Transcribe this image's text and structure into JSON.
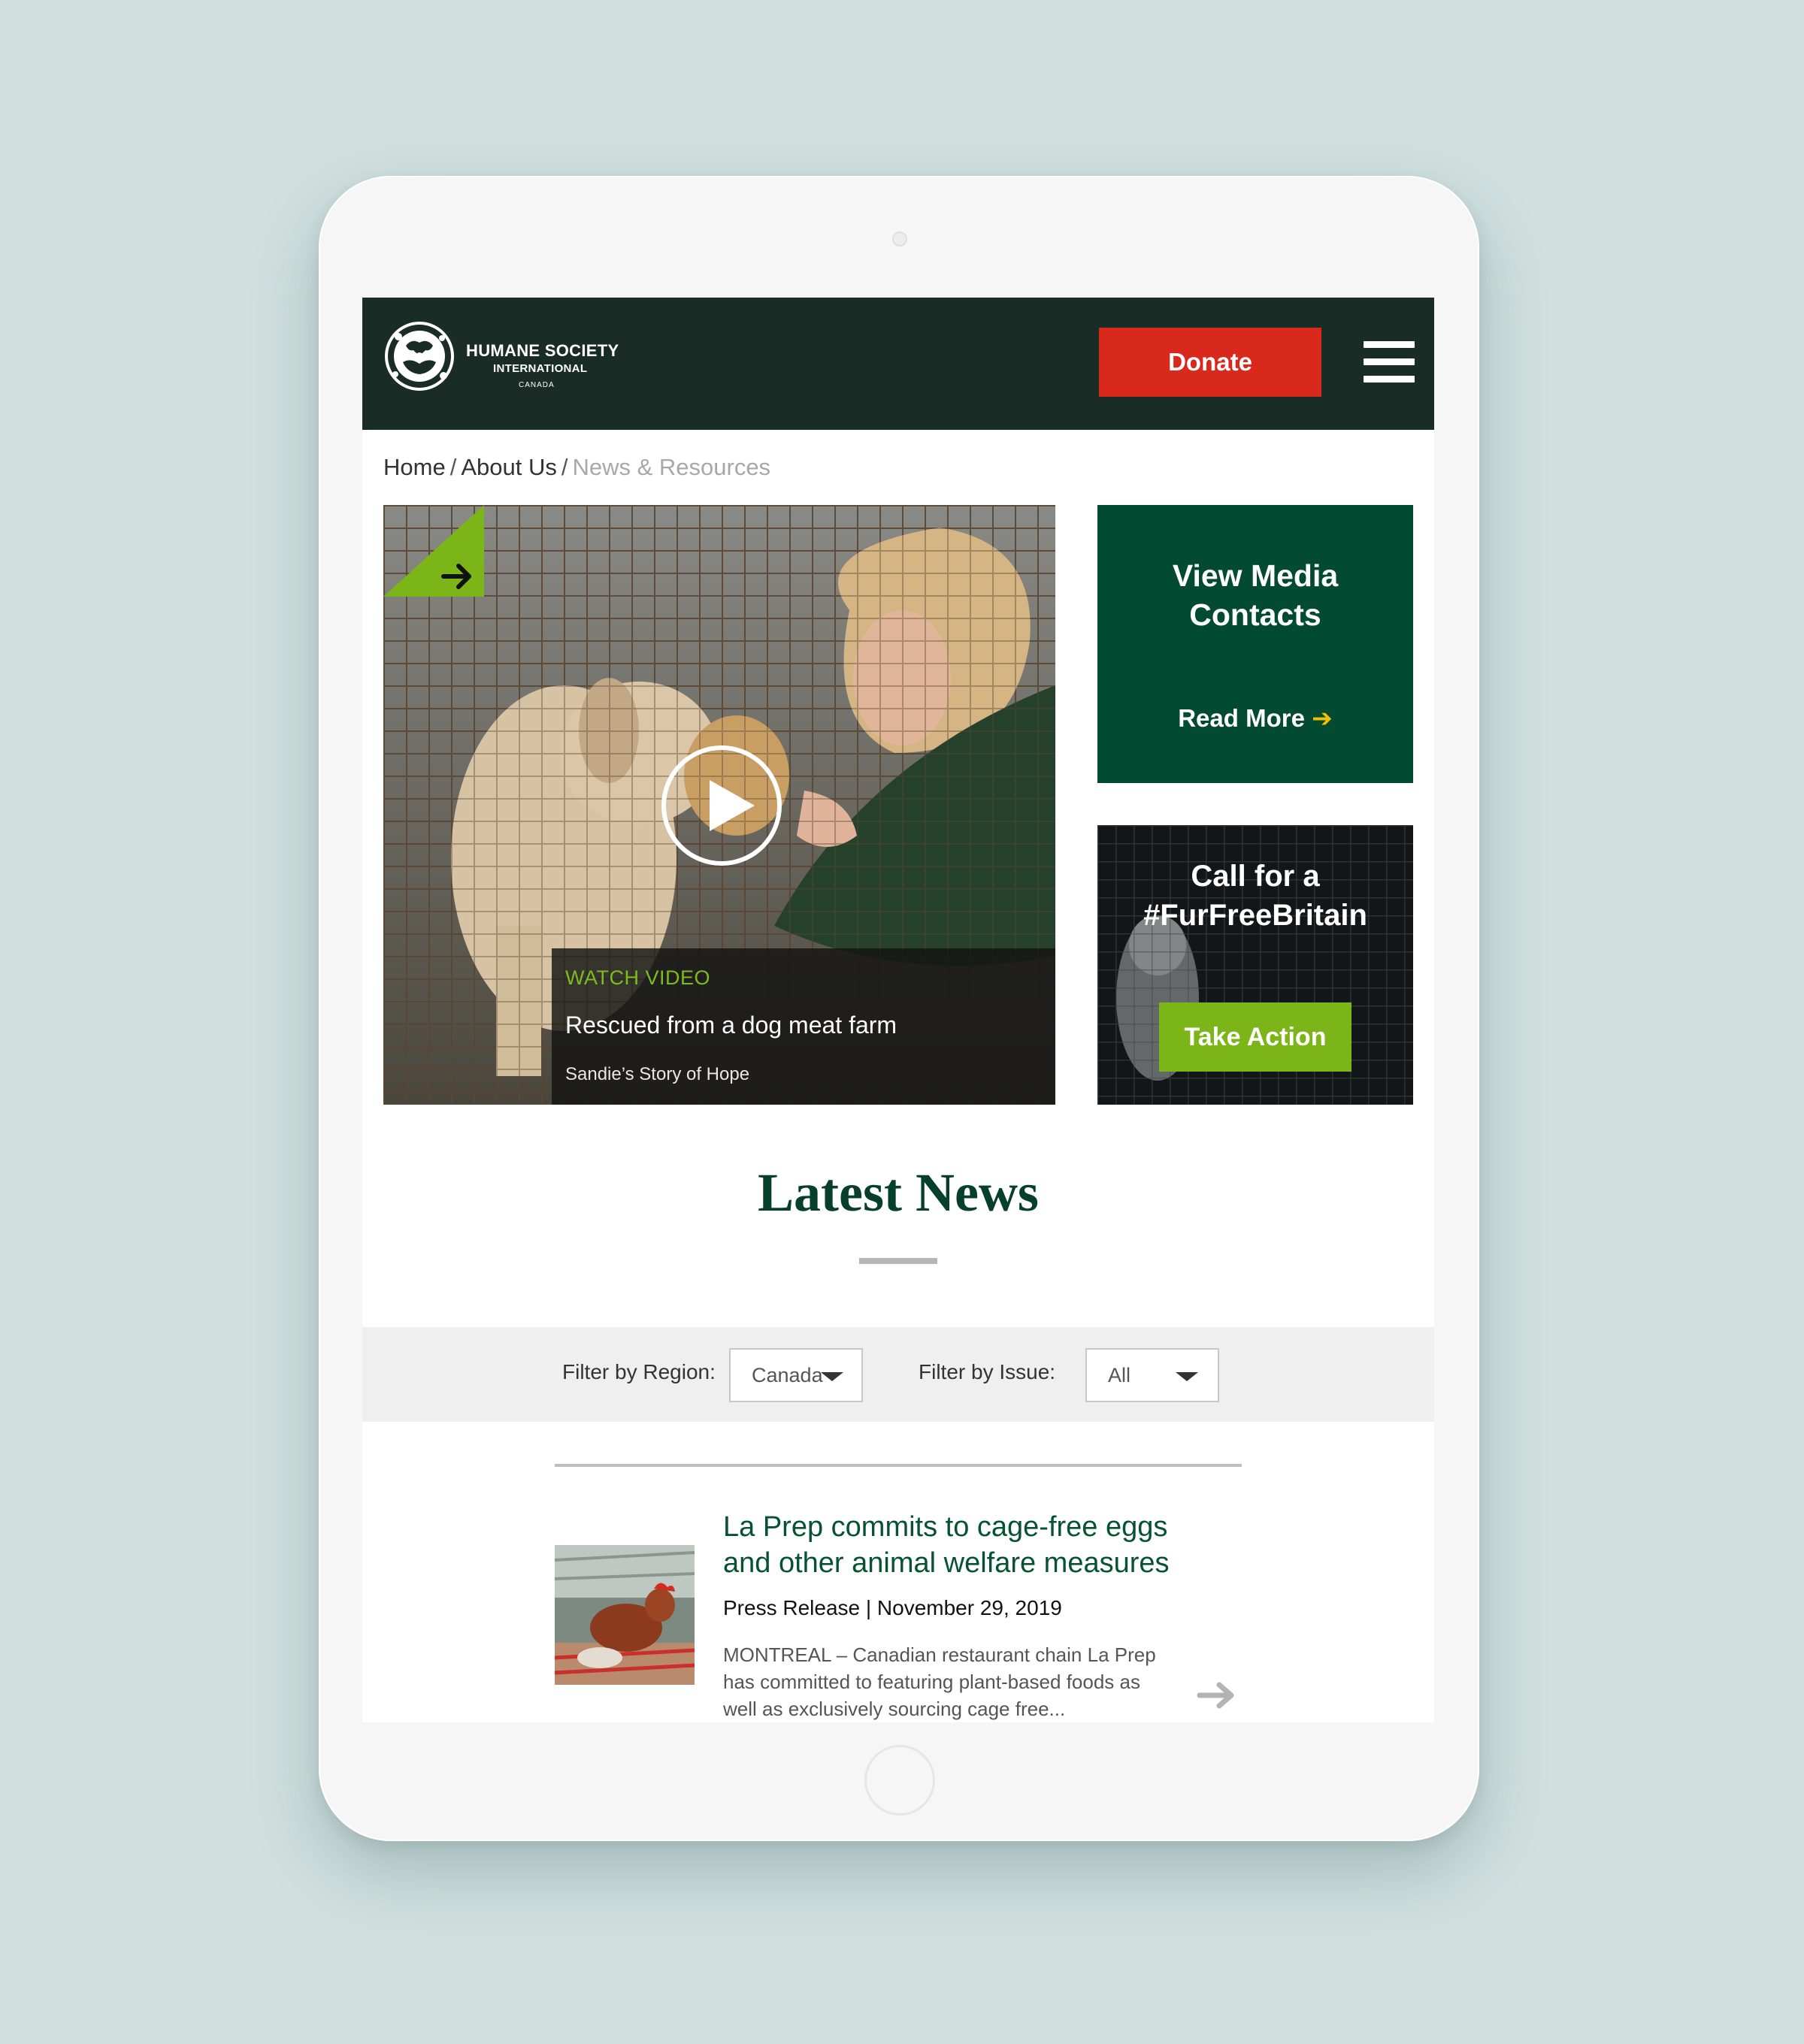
{
  "header": {
    "logo_line1": "HUMANE SOCIETY",
    "logo_line2": "INTERNATIONAL",
    "logo_line3": "CANADA",
    "donate_label": "Donate"
  },
  "breadcrumb": {
    "home": "Home",
    "about": "About Us",
    "current": "News & Resources",
    "separator": "/"
  },
  "hero": {
    "watch_label": "WATCH VIDEO",
    "title": "Rescued from a dog meat farm",
    "subtitle": "Sandie’s Story of Hope"
  },
  "media_card": {
    "title_line1": "View Media",
    "title_line2": "Contacts",
    "read_more": "Read More"
  },
  "fur_card": {
    "title_line1": "Call for a",
    "title_line2": "#FurFreeBritain",
    "button_label": "Take Action"
  },
  "latest_news": {
    "title": "Latest News"
  },
  "filters": {
    "region_label": "Filter by Region:",
    "region_value": "Canada",
    "issue_label": "Filter by Issue:",
    "issue_value": "All"
  },
  "news_items": [
    {
      "title": "La Prep commits to cage-free eggs and other animal welfare measures",
      "meta": "Press Release | November 29, 2019",
      "excerpt": "MONTREAL – Canadian restaurant chain La Prep has committed to featuring plant-based foods as well as exclusively sourcing cage free..."
    }
  ],
  "colors": {
    "header_bg": "#1a2c26",
    "donate": "#d9291c",
    "brand_green": "#034a32",
    "action_green": "#7cb518",
    "accent_yellow": "#f2c200"
  }
}
